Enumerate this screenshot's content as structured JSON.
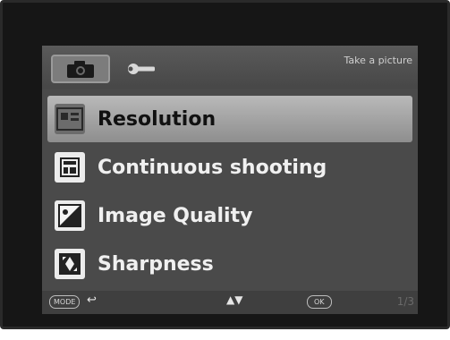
{
  "header": {
    "title": "Take a picture",
    "tabs": [
      {
        "icon": "camera-icon"
      },
      {
        "icon": "wrench-icon"
      }
    ]
  },
  "menu": {
    "items": [
      {
        "label": "Resolution",
        "icon": "resolution-icon",
        "selected": true
      },
      {
        "label": "Continuous shooting",
        "icon": "continuous-shooting-icon",
        "selected": false
      },
      {
        "label": "Image Quality",
        "icon": "image-quality-icon",
        "selected": false
      },
      {
        "label": "Sharpness",
        "icon": "sharpness-icon",
        "selected": false
      }
    ]
  },
  "footer": {
    "mode_label": "MODE",
    "back_glyph": "↩",
    "nav_glyph": "▲▼",
    "ok_label": "OK",
    "page": "1/3"
  },
  "colors": {
    "screen_bg": "#4a4a4a",
    "highlight": "#b0b0b0",
    "text": "#f0f0f0"
  }
}
